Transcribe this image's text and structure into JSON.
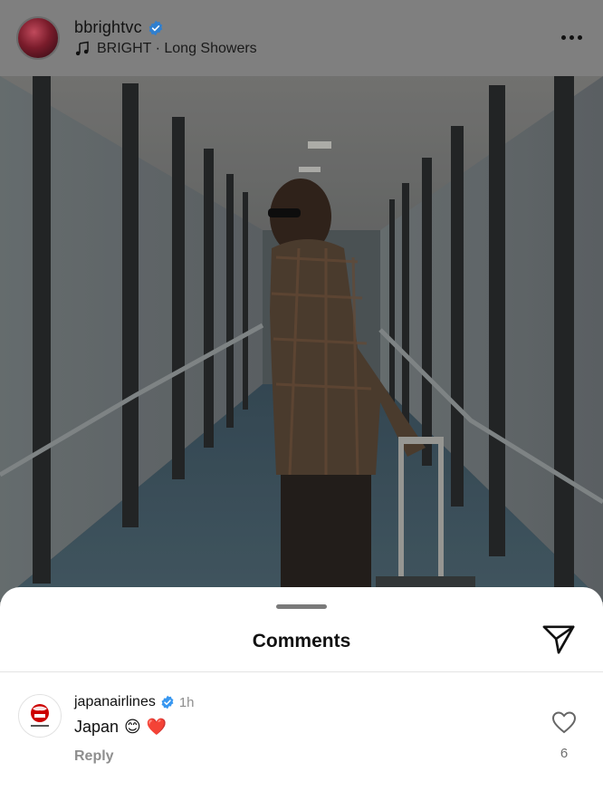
{
  "post": {
    "username": "bbrightvc",
    "verified": true,
    "audio": "BRIGHT · Long Showers",
    "more_icon": "more-horizontal-icon"
  },
  "comments_sheet": {
    "title": "Comments",
    "share_icon": "paper-plane-icon",
    "comments": [
      {
        "username": "japanairlines",
        "verified": true,
        "time": "1h",
        "text": "Japan",
        "emojis": [
          "😊",
          "❤️"
        ],
        "reply_label": "Reply",
        "like_count": "6"
      }
    ]
  },
  "colors": {
    "verified_blue": "#3897f0",
    "jal_red": "#cc0000",
    "overlay_dim": "#7f7f7f"
  }
}
